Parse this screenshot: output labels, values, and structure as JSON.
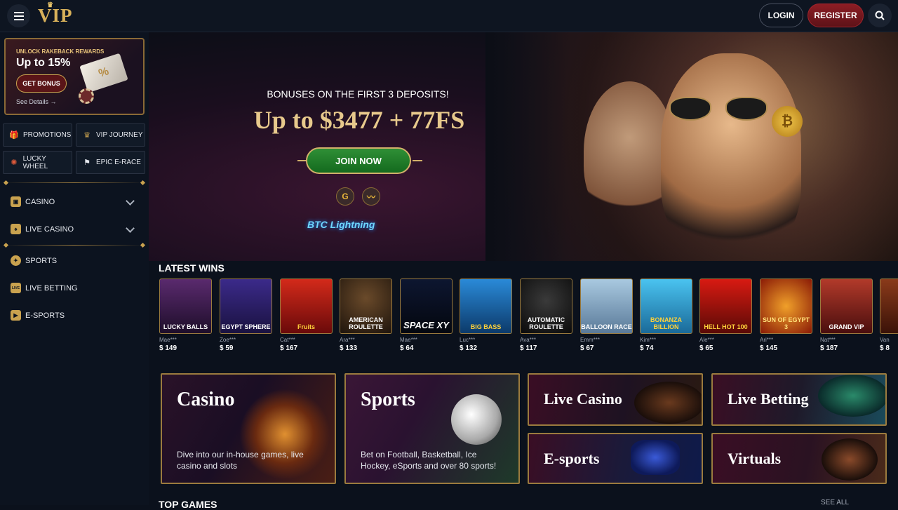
{
  "header": {
    "logo_text": "VIP",
    "login_label": "LOGIN",
    "register_label": "REGISTER"
  },
  "sidebar": {
    "promo": {
      "kicker": "UNLOCK RAKEBACK REWARDS",
      "headline": "Up to 15%",
      "button": "GET BONUS",
      "details": "See Details →"
    },
    "quick_links": [
      {
        "label": "PROMOTIONS",
        "icon": "gift-icon"
      },
      {
        "label": "VIP JOURNEY",
        "icon": "crown-icon"
      },
      {
        "label": "LUCKY WHEEL",
        "icon": "wheel-icon"
      },
      {
        "label": "EPIC E-RACE",
        "icon": "flag-icon"
      }
    ],
    "nav": [
      {
        "label": "CASINO",
        "icon": "slot-icon",
        "expandable": true
      },
      {
        "label": "LIVE CASINO",
        "icon": "card-icon",
        "expandable": true
      },
      {
        "label": "SPORTS",
        "icon": "ball-icon",
        "expandable": false
      },
      {
        "label": "LIVE BETTING",
        "icon": "live-icon",
        "icon_text": "LIVE",
        "expandable": false
      },
      {
        "label": "E-SPORTS",
        "icon": "play-icon",
        "expandable": false
      }
    ]
  },
  "hero": {
    "line1": "BONUSES ON THE FIRST 3 DEPOSITS!",
    "line2": "Up to $3477 + 77FS",
    "cta": "JOIN NOW",
    "payment_icons": [
      "google-pay-icon",
      "wallet-connect-icon"
    ],
    "lightning": "BTC Lightning"
  },
  "latest_wins": {
    "title": "LATEST WINS",
    "items": [
      {
        "game": "LUCKY BALLS",
        "user": "Mae***",
        "amount": "$ 149",
        "color": "#5a2a6e"
      },
      {
        "game": "EGYPT SPHERE",
        "user": "Zoe***",
        "amount": "$ 59",
        "color": "#3b2a8a"
      },
      {
        "game": "Fruits",
        "user": "Cat***",
        "amount": "$ 167",
        "color": "#b81414"
      },
      {
        "game": "AMERICAN ROULETTE",
        "user": "Ara***",
        "amount": "$ 133",
        "color": "#3a2a1e"
      },
      {
        "game": "SPACE XY",
        "user": "Mae***",
        "amount": "$ 64",
        "color": "#0d1630"
      },
      {
        "game": "BIG BASS",
        "user": "Luc***",
        "amount": "$ 132",
        "color": "#1a6fbf"
      },
      {
        "game": "AUTOMATIC ROULETTE",
        "user": "Ava***",
        "amount": "$ 117",
        "color": "#1a1a1a"
      },
      {
        "game": "BALLOON RACE",
        "user": "Emm***",
        "amount": "$ 67",
        "color": "#7aa7c9"
      },
      {
        "game": "BONANZA BILLION",
        "user": "Kim***",
        "amount": "$ 74",
        "color": "#3ab3e0"
      },
      {
        "game": "HELL HOT 100",
        "user": "Ale***",
        "amount": "$ 65",
        "color": "#b3120e"
      },
      {
        "game": "SUN OF EGYPT 3",
        "user": "Ari***",
        "amount": "$ 145",
        "color": "#c23a0a"
      },
      {
        "game": "GRAND VIP",
        "user": "Nat***",
        "amount": "$ 187",
        "color": "#8a1a1a"
      },
      {
        "game": "",
        "user": "Van",
        "amount": "$ 8",
        "color": "#6a2a1a"
      }
    ]
  },
  "categories": [
    {
      "title": "Casino",
      "desc": "Dive into our in-house games, live casino and slots"
    },
    {
      "title": "Sports",
      "desc": "Bet on Football, Basketball, Ice Hockey, eSports and over 80 sports!"
    },
    {
      "title": "Live Casino"
    },
    {
      "title": "Live Betting"
    },
    {
      "title": "E-sports"
    },
    {
      "title": "Virtuals"
    }
  ],
  "top_games": {
    "title": "TOP GAMES",
    "see_all": "SEE ALL"
  },
  "colors": {
    "gold": "#c9a24f",
    "register_red": "#8c1d24",
    "join_green": "#2f8f36",
    "bg": "#0b111c"
  }
}
